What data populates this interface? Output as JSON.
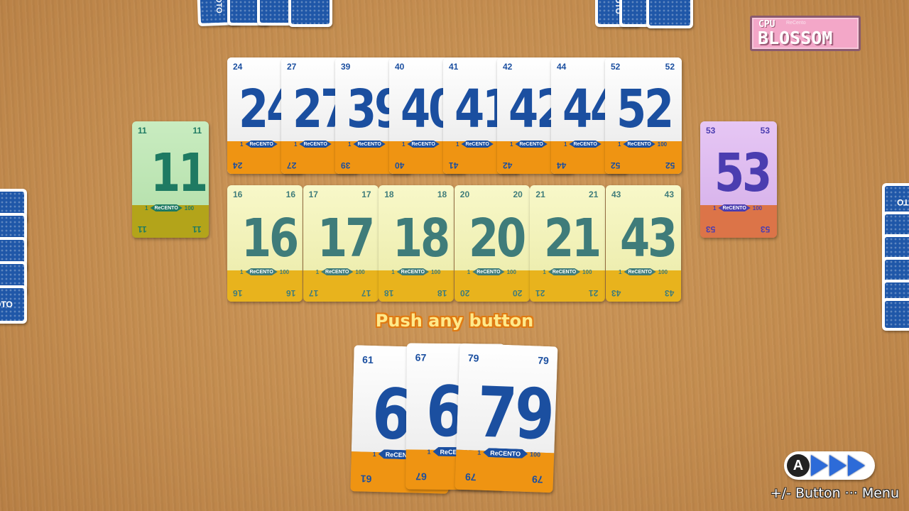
{
  "cpu": {
    "label": "CPU",
    "sublabel": "ReCento",
    "name": "BLOSSOM"
  },
  "card_back_text": "CENTO",
  "card_back_text_mirrored": "OTO",
  "scale": {
    "min": "1",
    "max": "100",
    "brand": "ReCENTO"
  },
  "blue_row": [
    "24",
    "27",
    "39",
    "40",
    "41",
    "42",
    "44",
    "52"
  ],
  "yellow_row": [
    "16",
    "17",
    "18",
    "20",
    "21",
    "43"
  ],
  "left_pile": "11",
  "right_pile": "53",
  "hand": [
    "61",
    "67",
    "79"
  ],
  "prompt": "Push any button",
  "controls": {
    "a_button": "A",
    "menu_hint": "+/- Button ··· Menu"
  },
  "colors": {
    "table": "#c38c4f",
    "card_blue": "#1b4fa0",
    "card_orange": "#ef9412",
    "card_yellow": "#f8f8c9",
    "card_green": "#c9ecc0",
    "card_purple": "#e6c6f4",
    "badge_pink": "#f3a7c8"
  }
}
